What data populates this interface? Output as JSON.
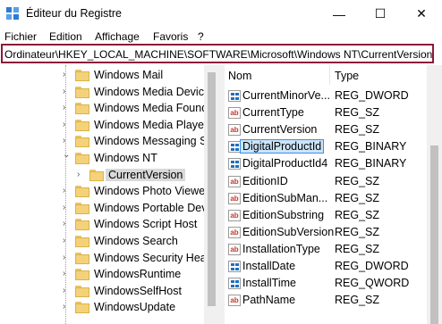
{
  "window": {
    "title": "Éditeur du Registre",
    "minimize": "—",
    "maximize": "☐",
    "close": "✕"
  },
  "menu": [
    "Fichier",
    "Edition",
    "Affichage",
    "Favoris",
    "?"
  ],
  "address": "Ordinateur\\HKEY_LOCAL_MACHINE\\SOFTWARE\\Microsoft\\Windows NT\\CurrentVersion",
  "tree": {
    "items": [
      {
        "label": "Windows Mail",
        "chevron": "›",
        "expanded": false
      },
      {
        "label": "Windows Media Device",
        "chevron": "›",
        "expanded": false
      },
      {
        "label": "Windows Media Foundation",
        "chevron": "›",
        "expanded": false
      },
      {
        "label": "Windows Media Player",
        "chevron": "›",
        "expanded": false
      },
      {
        "label": "Windows Messaging Subsystem",
        "chevron": "›",
        "expanded": false
      },
      {
        "label": "Windows NT",
        "chevron": "⌄",
        "expanded": true
      },
      {
        "label": "CurrentVersion",
        "chevron": "›",
        "expanded": false,
        "child": true,
        "selected": true
      },
      {
        "label": "Windows Photo Viewer",
        "chevron": "›",
        "expanded": false
      },
      {
        "label": "Windows Portable Devices",
        "chevron": "›",
        "expanded": false
      },
      {
        "label": "Windows Script Host",
        "chevron": "›",
        "expanded": false
      },
      {
        "label": "Windows Search",
        "chevron": "›",
        "expanded": false
      },
      {
        "label": "Windows Security Health",
        "chevron": "›",
        "expanded": false
      },
      {
        "label": "WindowsRuntime",
        "chevron": "›",
        "expanded": false
      },
      {
        "label": "WindowsSelfHost",
        "chevron": "›",
        "expanded": false
      },
      {
        "label": "WindowsUpdate",
        "chevron": "›",
        "expanded": false
      }
    ]
  },
  "values": {
    "header_name": "Nom",
    "header_type": "Type",
    "rows": [
      {
        "name": "CurrentMinorVe...",
        "type": "REG_DWORD",
        "icon": "binary"
      },
      {
        "name": "CurrentType",
        "type": "REG_SZ",
        "icon": "string"
      },
      {
        "name": "CurrentVersion",
        "type": "REG_SZ",
        "icon": "string"
      },
      {
        "name": "DigitalProductId",
        "type": "REG_BINARY",
        "icon": "binary",
        "selected": true
      },
      {
        "name": "DigitalProductId4",
        "type": "REG_BINARY",
        "icon": "binary"
      },
      {
        "name": "EditionID",
        "type": "REG_SZ",
        "icon": "string"
      },
      {
        "name": "EditionSubMan...",
        "type": "REG_SZ",
        "icon": "string"
      },
      {
        "name": "EditionSubstring",
        "type": "REG_SZ",
        "icon": "string"
      },
      {
        "name": "EditionSubVersion",
        "type": "REG_SZ",
        "icon": "string"
      },
      {
        "name": "InstallationType",
        "type": "REG_SZ",
        "icon": "string"
      },
      {
        "name": "InstallDate",
        "type": "REG_DWORD",
        "icon": "binary"
      },
      {
        "name": "InstallTime",
        "type": "REG_QWORD",
        "icon": "binary"
      },
      {
        "name": "PathName",
        "type": "REG_SZ",
        "icon": "string"
      }
    ]
  },
  "string_icon_text": "ab",
  "colors": {
    "address_border": "#8b1a3a",
    "selection_bg": "#cce4f7",
    "selection_border": "#3d8ee6",
    "folder": "#f4d27a"
  }
}
